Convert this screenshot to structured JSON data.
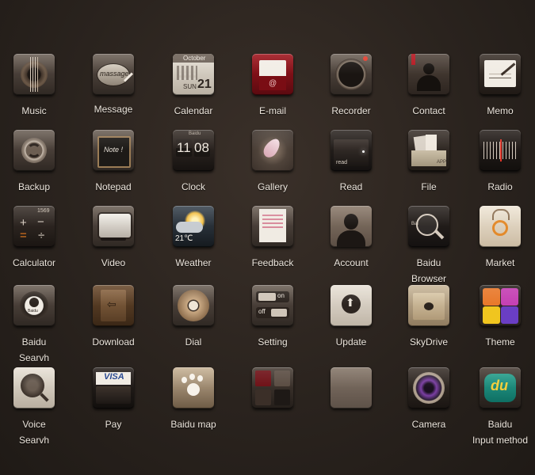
{
  "apps": {
    "music": "Music",
    "message": "Message",
    "calendar": "Calendar",
    "email": "E-mail",
    "recorder": "Recorder",
    "contact": "Contact",
    "memo": "Memo",
    "backup": "Backup",
    "notepad": "Notepad",
    "clock": "Clock",
    "gallery": "Gallery",
    "read": "Read",
    "file": "File",
    "radio": "Radio",
    "calculator": "Calculator",
    "video": "Video",
    "weather": "Weather",
    "feedback": "Feedback",
    "account": "Account",
    "baidu_browser_1": "Baidu",
    "baidu_browser_2": "Browser",
    "market": "Market",
    "baidu_search_1": "Baidu",
    "baidu_search_2": "Searvh",
    "download": "Download",
    "dial": "Dial",
    "setting": "Setting",
    "update": "Update",
    "skydrive": "SkyDrive",
    "theme": "Theme",
    "voice_search_1": "Voice",
    "voice_search_2": "Searvh",
    "pay": "Pay",
    "baidu_map": "Baidu map",
    "camera": "Camera",
    "baidu_input_1": "Baidu",
    "baidu_input_2": "Input method"
  },
  "icon_text": {
    "message": "massage",
    "calendar_month": "October",
    "calendar_day": "21",
    "calendar_weekday": "SUN",
    "notepad": "Note !",
    "clock_brand": "Baidu",
    "clock_hour": "11",
    "clock_min": "08",
    "read": "read",
    "file": "APP",
    "calculator": "1569",
    "weather": "21℃",
    "browser": "Bai",
    "search": "Baidu",
    "setting_on": "on",
    "setting_off": "off",
    "pay": "VISA",
    "input": "du"
  },
  "colors": {
    "background": "#2a231e",
    "label": "#ece5dc"
  }
}
